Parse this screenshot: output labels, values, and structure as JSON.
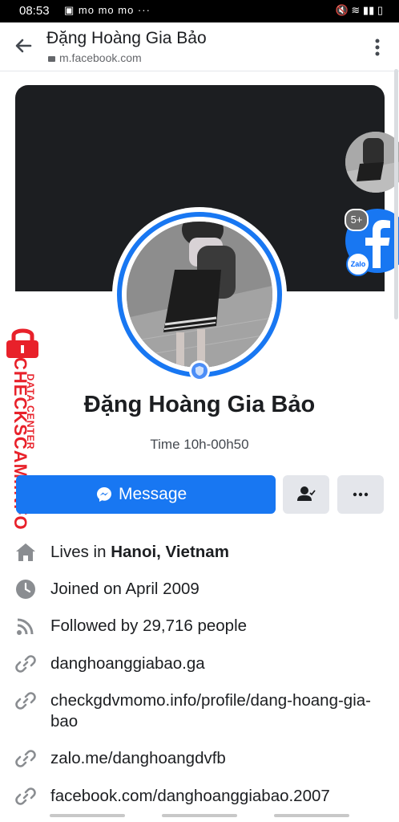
{
  "status_bar": {
    "time": "08:53",
    "left_icons": "▣ mo mo mo ···",
    "right_icons": "🔇 ≋ ▮▮ ▯"
  },
  "browser": {
    "page_title": "Đặng Hoàng Gia Bảo",
    "url": "m.facebook.com"
  },
  "profile": {
    "name": "Đặng Hoàng Gia Bảo",
    "bio": "Time 10h-00h50",
    "message_button_label": "Message"
  },
  "chat_heads": {
    "badge_count": "5+",
    "zalo_label": "Zalo"
  },
  "watermark": {
    "line1": "DATA CENTER",
    "line2": "CHECKSCAM.INFO"
  },
  "intro": {
    "lives_in_prefix": "Lives in ",
    "lives_in_place": "Hanoi, Vietnam",
    "joined": "Joined on April 2009",
    "followed": "Followed by 29,716 people",
    "links": [
      "danghoanggiabao.ga",
      "checkgdvmomo.info/profile/dang-hoang-gia-bao",
      "zalo.me/danghoangdvfb",
      "facebook.com/danghoanggiabao.2007"
    ]
  },
  "colors": {
    "facebook_blue": "#1877f2",
    "cover": "#1c1e21",
    "secondary_button": "#e4e6eb",
    "watermark_red": "#e8212a"
  }
}
